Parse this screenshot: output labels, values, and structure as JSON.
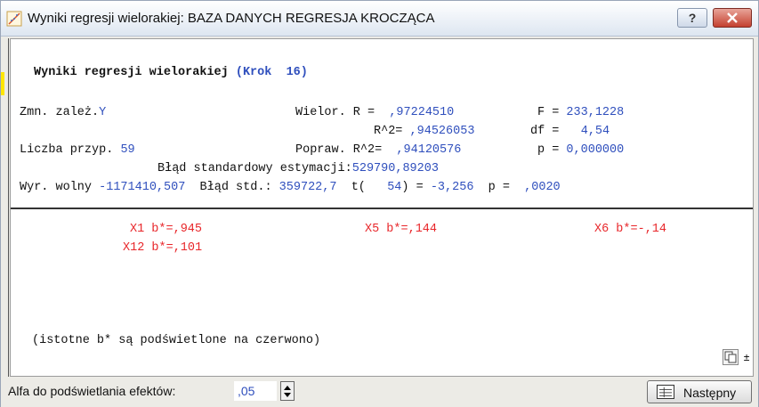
{
  "window": {
    "title": "Wyniki regresji wielorakiej: BAZA DANYCH REGRESJA KROCZĄCA",
    "help_label": "?",
    "close_label": "✕"
  },
  "results": {
    "heading_label": "Wyniki regresji wielorakiej",
    "heading_step": "(Krok  16)",
    "dep_var_label": "Zmn. zależ.",
    "dep_var_value": "Y",
    "multiple_r_label": "Wielor. R =",
    "multiple_r_value": ",97224510",
    "f_label": "F =",
    "f_value": "233,1228",
    "r2_label": "R^2=",
    "r2_value": ",94526053",
    "df_label": "df =",
    "df_value": "4,54",
    "n_label": "Liczba przyp.",
    "n_value": "59",
    "adj_r2_label": "Popraw. R^2=",
    "adj_r2_value": ",94120576",
    "p_label": "p =",
    "p_value": "0,000000",
    "se_est_label": "Błąd standardowy estymacji:",
    "se_est_value": "529790,89203",
    "intercept_label": "Wyr. wolny",
    "intercept_value": "-1171410,507",
    "intercept_se_label": "Błąd std.:",
    "intercept_se_value": "359722,7",
    "t_label": "t(",
    "t_df": "54",
    "t_rest": ") =",
    "t_value": "-3,256",
    "intercept_p_label": "p =",
    "intercept_p_value": ",0020"
  },
  "coefficients": [
    {
      "text": "X1 b*=,945"
    },
    {
      "text": "X5 b*=,144"
    },
    {
      "text": "X6 b*=-,14"
    },
    {
      "text": "X12 b*=,101"
    }
  ],
  "note": "(istotne b* są podświetlone na czerwono)",
  "footer": {
    "alpha_label": "Alfa do podświetlania efektów:",
    "alpha_value": ",05",
    "next_label": "Następny",
    "updown_label": "±"
  },
  "colors": {
    "value_blue": "#2f4fbd",
    "highlight_red": "#e8262a",
    "close_red": "#c4402f",
    "marker_yellow": "#ffe600"
  }
}
